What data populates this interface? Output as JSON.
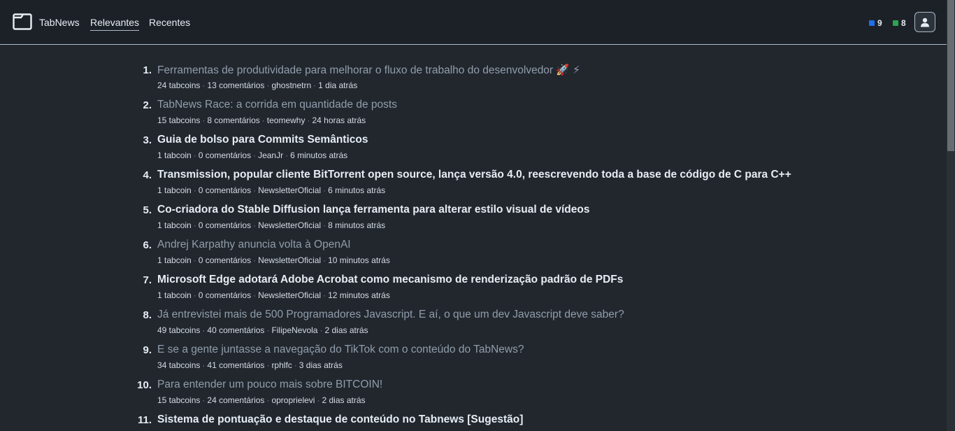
{
  "header": {
    "brand": "TabNews",
    "nav": {
      "relevantes": "Relevantes",
      "recentes": "Recentes"
    },
    "tabcoins": "9",
    "tabcash": "8",
    "colors": {
      "tabcoins": "#1f6feb",
      "tabcash": "#2da44e"
    }
  },
  "posts": [
    {
      "number": "1.",
      "title": "Ferramentas de produtividade para melhorar o fluxo de trabalho do desenvolvedor 🚀 ⚡",
      "read": true,
      "tabcoins": "24 tabcoins",
      "comments": "13 comentários",
      "author": "ghostnetrn",
      "time": "1 dia atrás"
    },
    {
      "number": "2.",
      "title": "TabNews Race: a corrida em quantidade de posts",
      "read": true,
      "tabcoins": "15 tabcoins",
      "comments": "8 comentários",
      "author": "teomewhy",
      "time": "24 horas atrás"
    },
    {
      "number": "3.",
      "title": "Guia de bolso para Commits Semânticos",
      "read": false,
      "tabcoins": "1 tabcoin",
      "comments": "0 comentários",
      "author": "JeanJr",
      "time": "6 minutos atrás"
    },
    {
      "number": "4.",
      "title": "Transmission, popular cliente BitTorrent open source, lança versão 4.0, reescrevendo toda a base de código de C para C++",
      "read": false,
      "tabcoins": "1 tabcoin",
      "comments": "0 comentários",
      "author": "NewsletterOficial",
      "time": "6 minutos atrás"
    },
    {
      "number": "5.",
      "title": "Co-criadora do Stable Diffusion lança ferramenta para alterar estilo visual de vídeos",
      "read": false,
      "tabcoins": "1 tabcoin",
      "comments": "0 comentários",
      "author": "NewsletterOficial",
      "time": "8 minutos atrás"
    },
    {
      "number": "6.",
      "title": "Andrej Karpathy anuncia volta à OpenAI",
      "read": true,
      "tabcoins": "1 tabcoin",
      "comments": "0 comentários",
      "author": "NewsletterOficial",
      "time": "10 minutos atrás"
    },
    {
      "number": "7.",
      "title": "Microsoft Edge adotará Adobe Acrobat como mecanismo de renderização padrão de PDFs",
      "read": false,
      "tabcoins": "1 tabcoin",
      "comments": "0 comentários",
      "author": "NewsletterOficial",
      "time": "12 minutos atrás"
    },
    {
      "number": "8.",
      "title": "Já entrevistei mais de 500 Programadores Javascript. E aí, o que um dev Javascript deve saber?",
      "read": true,
      "tabcoins": "49 tabcoins",
      "comments": "40 comentários",
      "author": "FilipeNevola",
      "time": "2 dias atrás"
    },
    {
      "number": "9.",
      "title": "E se a gente juntasse a navegação do TikTok com o conteúdo do TabNews?",
      "read": true,
      "tabcoins": "34 tabcoins",
      "comments": "41 comentários",
      "author": "rphlfc",
      "time": "3 dias atrás"
    },
    {
      "number": "10.",
      "title": "Para entender um pouco mais sobre BITCOIN!",
      "read": true,
      "tabcoins": "15 tabcoins",
      "comments": "24 comentários",
      "author": "oproprielevi",
      "time": "2 dias atrás"
    },
    {
      "number": "11.",
      "title": "Sistema de pontuação e destaque de conteúdo no Tabnews [Sugestão]",
      "read": false,
      "tabcoins": "",
      "comments": "",
      "author": "",
      "time": ""
    }
  ]
}
